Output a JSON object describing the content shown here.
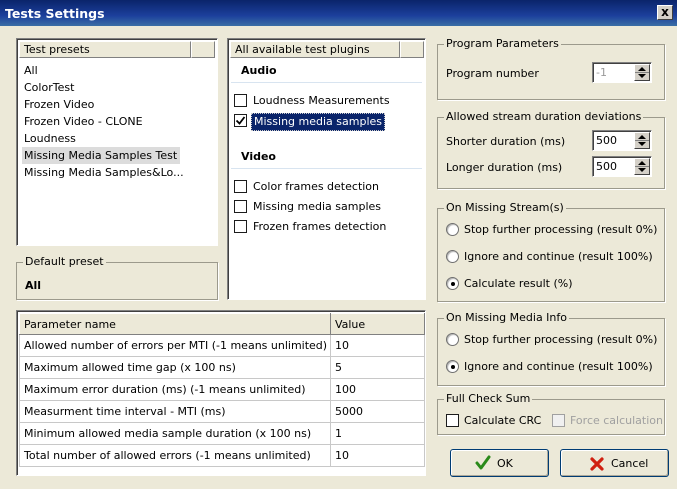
{
  "window": {
    "title": "Tests Settings",
    "close_label": "x"
  },
  "presets": {
    "header": "Test presets",
    "items": [
      "All",
      "ColorTest",
      "Frozen Video",
      "Frozen Video - CLONE",
      "Loudness",
      "Missing Media Samples Test",
      "Missing Media Samples&Lo..."
    ],
    "selected_index": 5
  },
  "default_preset": {
    "label": "Default preset",
    "value": "All"
  },
  "plugins": {
    "header": "All available test plugins",
    "audio_label": "Audio",
    "audio": [
      {
        "label": "Loudness Measurements",
        "checked": false
      },
      {
        "label": "Missing media samples",
        "checked": true
      }
    ],
    "video_label": "Video",
    "video": [
      {
        "label": "Color frames detection",
        "checked": false
      },
      {
        "label": "Missing media samples",
        "checked": false
      },
      {
        "label": "Frozen frames detection",
        "checked": false
      }
    ]
  },
  "params": {
    "col_name": "Parameter name",
    "col_value": "Value",
    "rows": [
      {
        "name": "Allowed number of errors per MTI (-1 means unlimited)",
        "value": "10"
      },
      {
        "name": "Maximum allowed time gap (x 100 ns)",
        "value": "5"
      },
      {
        "name": "Maximum error duration (ms) (-1 means unlimited)",
        "value": "100"
      },
      {
        "name": "Measurment time interval - MTI (ms)",
        "value": "5000"
      },
      {
        "name": "Minimum allowed media sample duration (x 100 ns)",
        "value": "1"
      },
      {
        "name": "Total number of allowed errors (-1 means unlimited)",
        "value": "10"
      }
    ]
  },
  "program_params": {
    "label": "Program Parameters",
    "program_number_label": "Program number",
    "program_number_value": "-1"
  },
  "duration": {
    "label": "Allowed stream duration deviations",
    "shorter_label": "Shorter duration (ms)",
    "shorter_value": "500",
    "longer_label": "Longer duration (ms)",
    "longer_value": "500"
  },
  "missing_stream": {
    "label": "On Missing Stream(s)",
    "options": [
      "Stop further processing (result 0%)",
      "Ignore and continue (result 100%)",
      "Calculate result (%)"
    ],
    "selected_index": 2
  },
  "missing_media": {
    "label": "On Missing Media Info",
    "options": [
      "Stop further processing (result 0%)",
      "Ignore and continue (result 100%)"
    ],
    "selected_index": 1
  },
  "checksum": {
    "label": "Full Check Sum",
    "calc_crc_label": "Calculate CRC",
    "force_label": "Force calculation"
  },
  "buttons": {
    "ok_label": "OK",
    "cancel_label": "Cancel"
  },
  "colors": {
    "title_bar": "#0a246a",
    "selection": "#0a246a",
    "ok_icon": "#2a8a1a",
    "cancel_icon": "#d02010"
  }
}
